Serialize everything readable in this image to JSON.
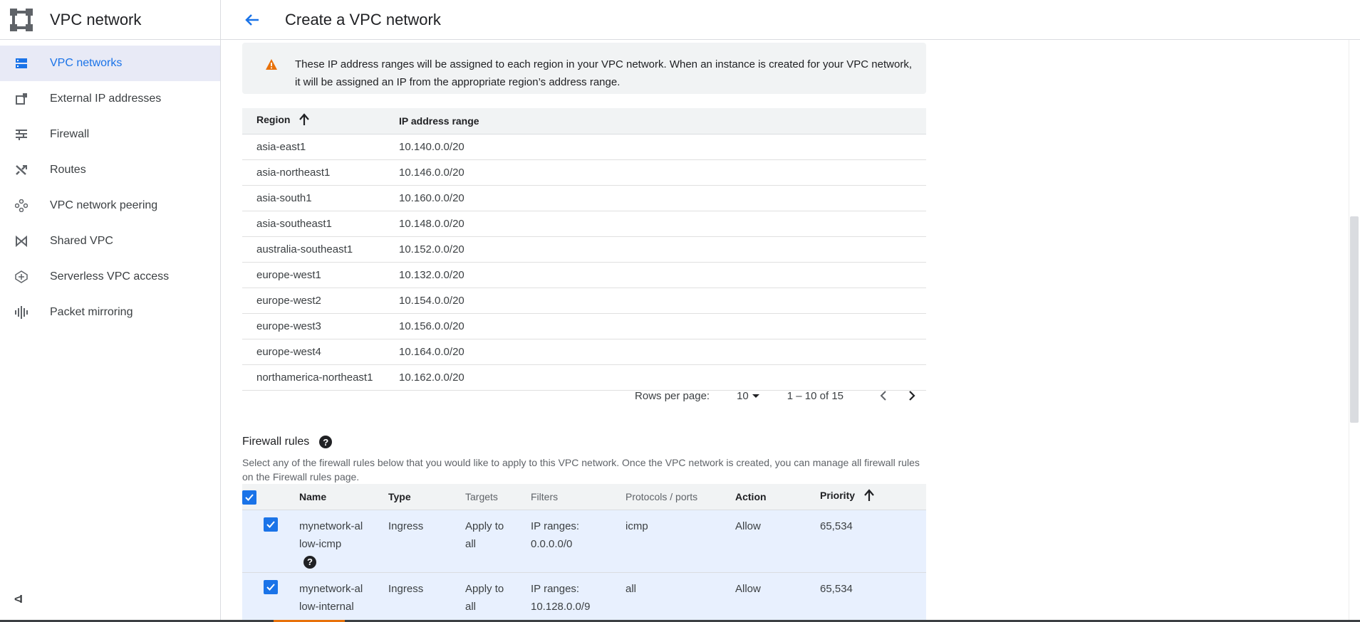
{
  "sidebar": {
    "title": "VPC network",
    "items": [
      {
        "label": "VPC networks",
        "icon": "vpc-networks-icon",
        "active": true
      },
      {
        "label": "External IP addresses",
        "icon": "external-ip-icon"
      },
      {
        "label": "Firewall",
        "icon": "firewall-icon"
      },
      {
        "label": "Routes",
        "icon": "routes-icon"
      },
      {
        "label": "VPC network peering",
        "icon": "peering-icon"
      },
      {
        "label": "Shared VPC",
        "icon": "shared-vpc-icon"
      },
      {
        "label": "Serverless VPC access",
        "icon": "serverless-icon"
      },
      {
        "label": "Packet mirroring",
        "icon": "packet-mirroring-icon"
      }
    ],
    "collapse_label": "<I"
  },
  "header": {
    "title": "Create a VPC network"
  },
  "banner": {
    "text": "These IP address ranges will be assigned to each region in your VPC network. When an instance is created for your VPC network, it will be assigned an IP from the appropriate region’s address range."
  },
  "region_table": {
    "columns": [
      "Region",
      "IP address range"
    ],
    "rows": [
      [
        "asia-east1",
        "10.140.0.0/20"
      ],
      [
        "asia-northeast1",
        "10.146.0.0/20"
      ],
      [
        "asia-south1",
        "10.160.0.0/20"
      ],
      [
        "asia-southeast1",
        "10.148.0.0/20"
      ],
      [
        "australia-southeast1",
        "10.152.0.0/20"
      ],
      [
        "europe-west1",
        "10.132.0.0/20"
      ],
      [
        "europe-west2",
        "10.154.0.0/20"
      ],
      [
        "europe-west3",
        "10.156.0.0/20"
      ],
      [
        "europe-west4",
        "10.164.0.0/20"
      ],
      [
        "northamerica-northeast1",
        "10.162.0.0/20"
      ]
    ]
  },
  "pager": {
    "rows_per_page_label": "Rows per page:",
    "rows_per_page_value": "10",
    "range_text": "1 – 10 of 15"
  },
  "firewall": {
    "title": "Firewall rules",
    "description": "Select any of the firewall rules below that you would like to apply to this VPC network. Once the VPC network is created, you can manage all firewall rules on the Firewall rules page.",
    "columns": [
      "Name",
      "Type",
      "Targets",
      "Filters",
      "Protocols / ports",
      "Action",
      "Priority"
    ],
    "rows": [
      {
        "name": "mynetwork-allow-icmp",
        "type": "Ingress",
        "targets": "Apply to all",
        "filters": "IP ranges: 0.0.0.0/0",
        "protocols": "icmp",
        "action": "Allow",
        "priority": "65,534"
      },
      {
        "name": "mynetwork-allow-internal",
        "type": "Ingress",
        "targets": "Apply to all",
        "filters": "IP ranges: 10.128.0.0/9",
        "protocols": "all",
        "action": "Allow",
        "priority": "65,534"
      }
    ]
  },
  "colors": {
    "accent": "#1a73e8",
    "warning": "#e8710a"
  }
}
